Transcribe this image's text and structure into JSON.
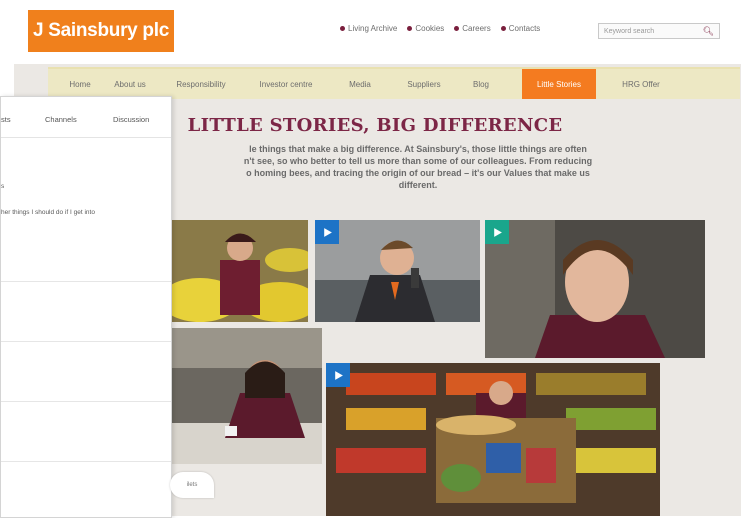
{
  "brand": {
    "logo_text": "J Sainsbury plc",
    "accent": "#f0801c",
    "maroon": "#7c2646",
    "nav_bg": "#ede8c4",
    "play_blue": "#1d73c6",
    "play_green": "#1aa68c"
  },
  "top_links": [
    "Living Archive",
    "Cookies",
    "Careers",
    "Contacts"
  ],
  "search": {
    "placeholder": "Keyword search"
  },
  "nav": [
    "Home",
    "About us",
    "Responsibility",
    "Investor centre",
    "Media",
    "Suppliers",
    "Blog",
    "Little Stories",
    "HRG Offer"
  ],
  "nav_active": "Little Stories",
  "main": {
    "title": "LITTLE STORIES, BIG DIFFERENCE",
    "intro_lines": [
      "le things that make a big difference. At Sainsbury's, those little things are often",
      "n't see, so who better to tell us more than some of our colleagues. From reducing",
      "o homing bees, and tracing the origin of our bread – it's our Values that make us",
      "different."
    ]
  },
  "panel": {
    "tabs": [
      "sts",
      "Channels",
      "Discussion"
    ],
    "row1": {
      "line1": "s",
      "line2": "her things I should do if I get into"
    }
  },
  "bubble": {
    "label": "ilets"
  }
}
